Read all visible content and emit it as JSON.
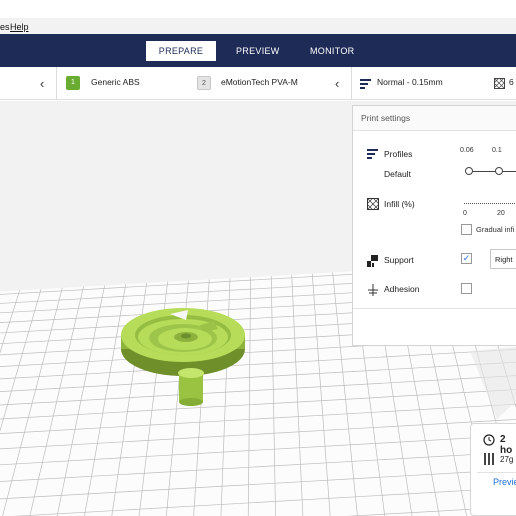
{
  "menu": {
    "items": [
      "es",
      "Help"
    ]
  },
  "stages": {
    "prepare": "PREPARE",
    "preview": "PREVIEW",
    "monitor": "MONITOR"
  },
  "extruders": [
    {
      "number": "1",
      "material": "Generic ABS",
      "color": "#6aab32"
    },
    {
      "number": "2",
      "material": "eMotionTech PVA-M",
      "color": "#dddddd"
    }
  ],
  "profile_bar": {
    "quality": "Normal - 0.15mm",
    "infill_partial": "6"
  },
  "print_settings": {
    "title": "Print settings",
    "profiles_label": "Profiles",
    "default_label": "Default",
    "layer_ticks": [
      "0.06",
      "0.1"
    ],
    "infill_label": "Infill (%)",
    "infill_ticks": [
      "0",
      "20"
    ],
    "gradual_label": "Gradual infi",
    "support_label": "Support",
    "support_checked": true,
    "support_extruder": "Right",
    "adhesion_label": "Adhesion",
    "adhesion_checked": false
  },
  "estimate": {
    "time": "2 ho",
    "weight": "27g",
    "preview_button": "Previe"
  },
  "colors": {
    "topbar": "#1e2b57",
    "model": "#b6dc5a",
    "accent": "#1e6fd9"
  }
}
